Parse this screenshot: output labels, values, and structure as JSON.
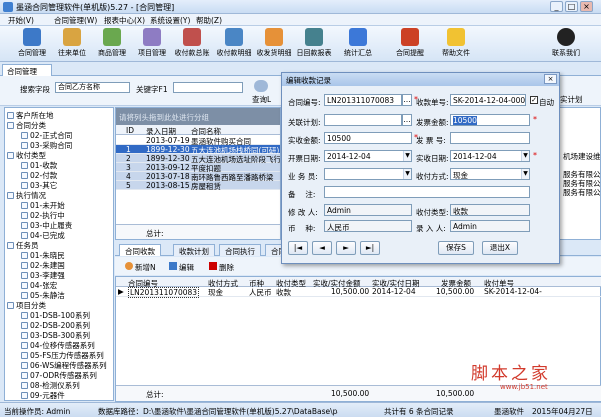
{
  "window": {
    "title": "墨涵合同管理软件(单机版)5.27 - [合同管理]",
    "min": "_",
    "max": "□",
    "close": "×"
  },
  "menu": [
    "开始(V)",
    "合同管理(W)",
    "报表中心(X)",
    "系统设置(Y)",
    "帮助(Z)"
  ],
  "toolbar": [
    "合同管理",
    "往来单位",
    "商品管理",
    "项目管理",
    "收付款总账",
    "收付款明细",
    "收发货明细",
    "日回款报表",
    "统计汇总",
    "合同提醒",
    "帮助文件",
    "联系我们"
  ],
  "tab": "合同管理",
  "filters": {
    "search_field_label": "搜索字段",
    "search_field_value": "合同乙方名称",
    "keyword_label": "关键字F1",
    "query_button": "查询L",
    "right_cut": "实计划"
  },
  "tree": [
    {
      "label": "客户所在地",
      "level": 0
    },
    {
      "label": "合同分类",
      "level": 0
    },
    {
      "label": "02-正式合同",
      "level": 1
    },
    {
      "label": "03-采购合同",
      "level": 1
    },
    {
      "label": "收付类型",
      "level": 0
    },
    {
      "label": "01-收款",
      "level": 1
    },
    {
      "label": "02-付款",
      "level": 1
    },
    {
      "label": "03-其它",
      "level": 1
    },
    {
      "label": "执行情况",
      "level": 0
    },
    {
      "label": "01-未开始",
      "level": 1
    },
    {
      "label": "02-执行中",
      "level": 1
    },
    {
      "label": "03-中止履责",
      "level": 1
    },
    {
      "label": "04-已完成",
      "level": 1
    },
    {
      "label": "任务员",
      "level": 0
    },
    {
      "label": "01-朱晓民",
      "level": 1
    },
    {
      "label": "02-朱建国",
      "level": 1
    },
    {
      "label": "03-李建强",
      "level": 1
    },
    {
      "label": "04-张宏",
      "level": 1
    },
    {
      "label": "05-朱静洁",
      "level": 1
    },
    {
      "label": "项目分类",
      "level": 0
    },
    {
      "label": "01-DSB-100系列",
      "level": 1
    },
    {
      "label": "02-DSB-200系列",
      "level": 1
    },
    {
      "label": "03-DSB-300系列",
      "level": 1
    },
    {
      "label": "04-位移传感器系列",
      "level": 1
    },
    {
      "label": "05-FS压力传感器系列",
      "level": 1
    },
    {
      "label": "06-WS编程传感器系列",
      "level": 1
    },
    {
      "label": "07-ODR传感器系列",
      "level": 1
    },
    {
      "label": "08-检测仪系列",
      "level": 1
    },
    {
      "label": "09-元器件",
      "level": 1
    }
  ],
  "grid": {
    "group_hint": "请将列头拖到此处进行分组",
    "columns": [
      "ID",
      "录入日期",
      "合同名称"
    ],
    "rows": [
      {
        "id": "",
        "date": "2013-07-19",
        "name": "墨涵软件购买合同"
      },
      {
        "id": "1",
        "date": "1899-12-30",
        "name": "五大连池机场栈桥同(可研)"
      },
      {
        "id": "2",
        "date": "1899-12-30",
        "name": "五大连池机场选址阶段飞行"
      },
      {
        "id": "3",
        "date": "2013-09-12",
        "name": "平度扣题"
      },
      {
        "id": "4",
        "date": "2013-07-18",
        "name": "南环路鲁西路至潘路桥梁"
      },
      {
        "id": "5",
        "date": "2013-08-15",
        "name": "房屋租赁"
      }
    ],
    "total_label": "总计:"
  },
  "right_snippets": [
    "机场建设维",
    "服务有限公",
    "服务有限公",
    "服务有限公"
  ],
  "subtabs": [
    "合同收款",
    "收款计划",
    "合同执行",
    "合同"
  ],
  "subtool": {
    "new": "新增N",
    "edit": "编辑",
    "delete": "删除"
  },
  "bottom_grid": {
    "columns": [
      "合同编号",
      "收付方式",
      "币种",
      "收付类型",
      "实收/实付金额",
      "实收/实付日期",
      "发票金额",
      "收付单号"
    ],
    "row": {
      "contract_no": "LN201311070083",
      "method": "现金",
      "currency": "人民币",
      "type": "收款",
      "amount": "10,500.00",
      "date": "2014-12-04",
      "invoice": "10,500.00",
      "no": "SK-2014-12-04-"
    },
    "total_label": "总计:",
    "total_amount": "10,500.00",
    "total_invoice": "10,500.00"
  },
  "dialog": {
    "title": "编辑收款记录",
    "close": "×",
    "contract_no_label": "合同编号:",
    "contract_no": "LN201311070083",
    "receipt_no_label": "收款单号:",
    "receipt_no": "SK-2014-12-04-0001",
    "auto_label": "自动",
    "related_plan_label": "关联计划:",
    "related_plan": "",
    "invoice_amount_label": "发票金额:",
    "invoice_amount": "10500",
    "actual_amount_label": "实收金额:",
    "actual_amount": "10500",
    "invoice_no_label": "发 票 号:",
    "invoice_no": "",
    "invoice_date_label": "开票日期:",
    "invoice_date": "2014-12-04",
    "receive_date_label": "实收日期:",
    "receive_date": "2014-12-04",
    "salesman_label": "业 务 员:",
    "salesman": "",
    "method_label": "收付方式:",
    "method": "现金",
    "remark_label": "备　 注:",
    "remark": "",
    "modifier_label": "修 改 人:",
    "modifier": "Admin",
    "type_label": "收付类型:",
    "type": "收款",
    "currency_label": "币　 种:",
    "currency": "人民币",
    "entry_label": "录 入 人:",
    "entry": "Admin",
    "nav_first": "|◄",
    "nav_prev": "◄",
    "nav_next": "►",
    "nav_last": "►|",
    "save": "保存S",
    "exit": "退出X"
  },
  "status": {
    "operator": "当前操作员: Admin",
    "db": "数据库路径：D:\\墨涵软件\\墨涵合同管理软件(单机版)5.27\\DataBase\\pact.mdb",
    "count": "共计有 6 条合同记录",
    "company": "墨涵软件",
    "date": "2015年04月27日"
  },
  "watermark": {
    "text": "脚本之家",
    "url": "www.jb51.net"
  }
}
